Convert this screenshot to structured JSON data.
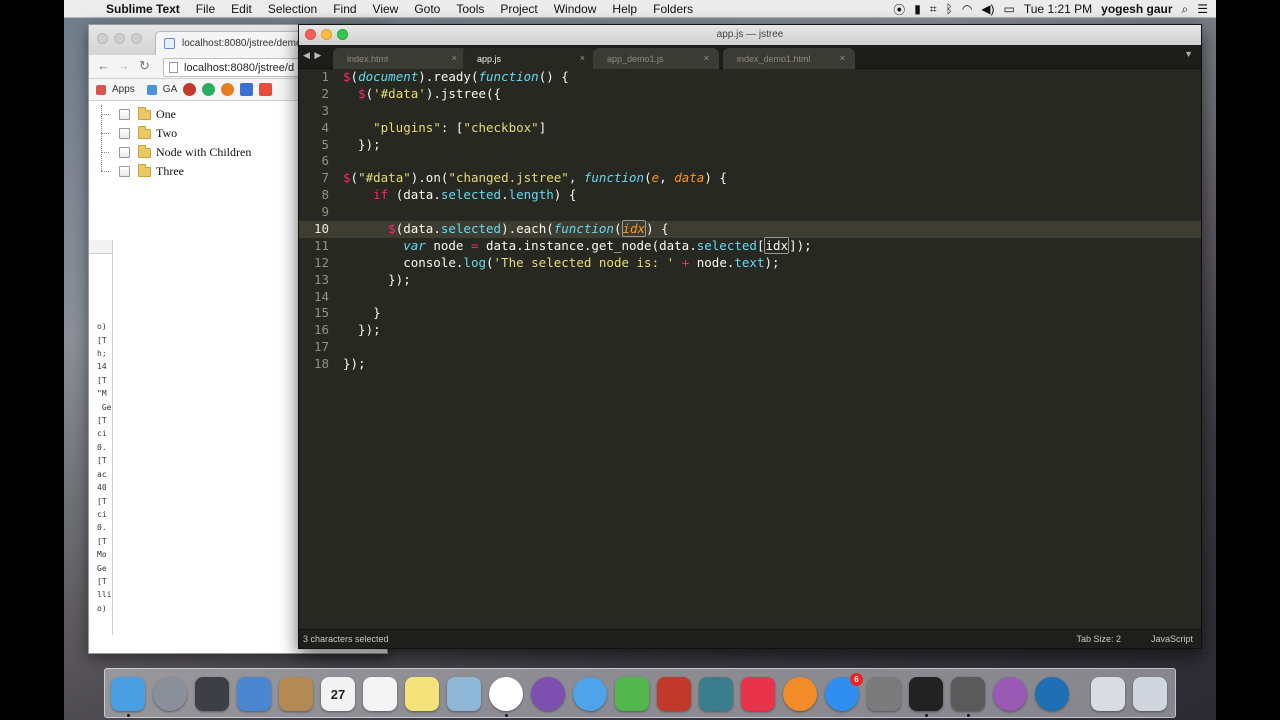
{
  "menubar": {
    "app_name": "Sublime Text",
    "items": [
      "File",
      "Edit",
      "Selection",
      "Find",
      "View",
      "Goto",
      "Tools",
      "Project",
      "Window",
      "Help",
      "Folders"
    ],
    "clock": "Tue 1:21 PM",
    "user": "yogesh gaur"
  },
  "browser": {
    "tab_title": "localhost:8080/jstree/demo",
    "url": "localhost:8080/jstree/d",
    "bookmarks": [
      "Apps",
      "GA"
    ],
    "tree_nodes": [
      "One",
      "Two",
      "Node with Children",
      "Three"
    ],
    "console_lines": "lli\no)\n[T\nh;\n14\n[T\n\"M\n Ge\n[T\nci\n0.\n[T\nac\n40\n[T\nci\n0.\n[T\nMo\nGe\n[T\nlli\no)"
  },
  "editor": {
    "window_title": "app.js — jstree",
    "tabs": [
      {
        "label": "index.html",
        "active": false
      },
      {
        "label": "app.js",
        "active": true
      },
      {
        "label": "app_demo1.js",
        "active": false
      },
      {
        "label": "index_demo1.html",
        "active": false
      }
    ],
    "line_numbers": [
      "1",
      "2",
      "3",
      "4",
      "5",
      "6",
      "7",
      "8",
      "9",
      "10",
      "11",
      "12",
      "13",
      "14",
      "15",
      "16",
      "17",
      "18"
    ],
    "current_line": "10"
  },
  "statusbar": {
    "left": "3 characters selected",
    "tab_size": "Tab Size: 2",
    "syntax": "JavaScript"
  },
  "dock": {
    "icons": [
      "finder-icon",
      "launchpad-icon",
      "mission-control-icon",
      "preview-icon",
      "contacts-icon",
      "calendar-icon",
      "reminders-icon",
      "notes-icon",
      "photos-icon",
      "chrome-icon",
      "appstore-purple-icon",
      "messages-icon",
      "facetime-icon",
      "photo-booth-icon",
      "image-capture-icon",
      "itunes-icon",
      "ibooks-icon",
      "app-store-icon",
      "system-preferences-icon",
      "terminal-icon",
      "sublime-icon",
      "sync-icon",
      "quicktime-icon",
      "documents-icon",
      "trash-icon"
    ],
    "calendar_day": "27",
    "app_store_badge": "6"
  }
}
